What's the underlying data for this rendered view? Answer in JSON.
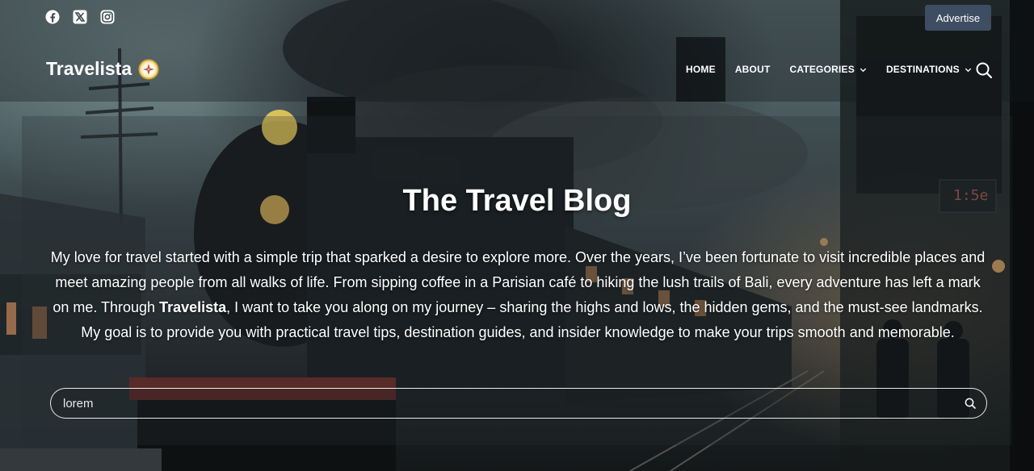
{
  "social": [
    {
      "icon": "facebook-icon"
    },
    {
      "icon": "x-twitter-icon"
    },
    {
      "icon": "instagram-icon"
    }
  ],
  "advertise_label": "Advertise",
  "brand": {
    "name": "Travelista",
    "logo_icon": "compass-icon"
  },
  "nav": [
    {
      "label": "HOME",
      "active": true,
      "dropdown": false
    },
    {
      "label": "ABOUT",
      "active": false,
      "dropdown": false
    },
    {
      "label": "CATEGORIES",
      "active": false,
      "dropdown": true
    },
    {
      "label": "DESTINATIONS",
      "active": false,
      "dropdown": true
    }
  ],
  "hero": {
    "title": "The Travel Blog",
    "text_before": "My love for travel started with a simple trip that sparked a desire to explore more. Over the years, I’ve been fortunate to visit incredible places and meet amazing people from all walks of life. From sipping coffee in a Parisian café to hiking the lush trails of Bali, every adventure has left a mark on me. Through ",
    "text_bold": "Travelista",
    "text_after": ", I want to take you along on my journey – sharing the highs and lows, the hidden gems, and the must-see landmarks. My goal is to provide you with practical travel tips, destination guides, and insider knowledge to make your trips smooth and memorable."
  },
  "search": {
    "value": "lorem",
    "placeholder": "Search"
  },
  "colors": {
    "advertise_bg": "#3f4d63",
    "nav_active_bg": "#0c0f11",
    "text": "#ffffff"
  }
}
